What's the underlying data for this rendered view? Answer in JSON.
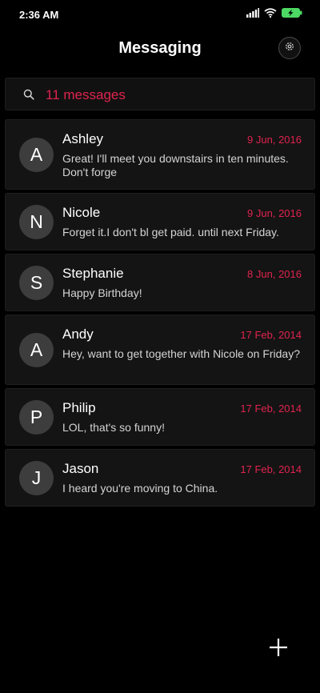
{
  "status_bar": {
    "time": "2:36 AM",
    "icons": [
      "signal-icon",
      "wifi-icon",
      "battery-charging-icon"
    ]
  },
  "header": {
    "title": "Messaging",
    "settings_icon": "gear-icon"
  },
  "search": {
    "icon": "search-icon",
    "text": "11 messages"
  },
  "colors": {
    "accent": "#e0234e",
    "background": "#000000",
    "card": "#141414",
    "avatar": "#3d3d3d",
    "battery": "#4cd964"
  },
  "conversations": [
    {
      "initial": "A",
      "name": "Ashley",
      "date": "9 Jun, 2016",
      "preview": "Great! I'll meet you downstairs in ten minutes. Don't forge"
    },
    {
      "initial": "N",
      "name": "Nicole",
      "date": "9 Jun, 2016",
      "preview": "Forget it.I don't bl get paid. until next Friday."
    },
    {
      "initial": "S",
      "name": "Stephanie",
      "date": "8 Jun, 2016",
      "preview": "Happy Birthday!"
    },
    {
      "initial": "A",
      "name": "Andy",
      "date": "17 Feb, 2014",
      "preview": "Hey, want to get together with Nicole on Friday?"
    },
    {
      "initial": "P",
      "name": "Philip",
      "date": "17 Feb, 2014",
      "preview": "LOL, that's so funny!"
    },
    {
      "initial": "J",
      "name": "Jason",
      "date": "17 Feb, 2014",
      "preview": "I heard you're moving to China."
    }
  ],
  "compose": {
    "icon": "plus-icon"
  }
}
